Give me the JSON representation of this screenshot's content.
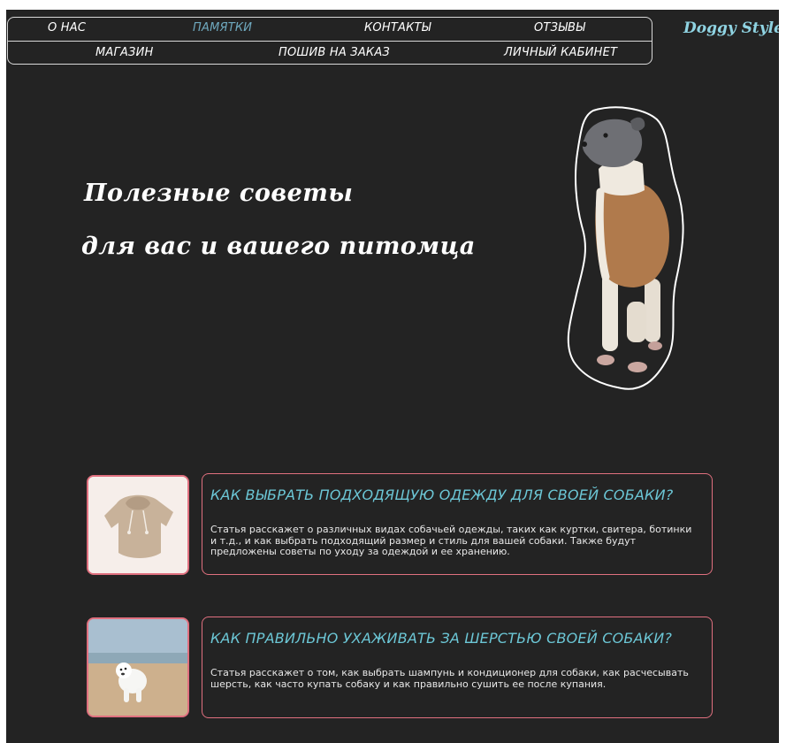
{
  "nav": {
    "items": [
      "О НАС",
      "ПАМЯТКИ",
      "КОНТАКТЫ",
      "ОТЗЫВЫ",
      "МАГАЗИН",
      "ПОШИВ НА ЗАКАЗ",
      "ЛИЧНЫЙ КАБИНЕТ"
    ],
    "active": "ПАМЯТКИ"
  },
  "brand": "Doggy Style",
  "hero": {
    "line1": "Полезные советы",
    "line2": "для вас и вашего питомца"
  },
  "articles": [
    {
      "title": "КАК ВЫБРАТЬ ПОДХОДЯЩУЮ ОДЕЖДУ ДЛЯ СВОЕЙ СОБАКИ?",
      "text": "Статья расскажет о различных видах собачьей одежды, таких как куртки, свитера, ботинки и т.д., и как выбрать подходящий размер и стиль для вашей собаки. Также будут предложены советы по уходу за одеждой и ее хранению."
    },
    {
      "title": "КАК ПРАВИЛЬНО УХАЖИВАТЬ ЗА ШЕРСТЬЮ СВОЕЙ СОБАКИ?",
      "text": "Статья расскажет о том, как выбрать шампунь и кондиционер для собаки, как расчесывать шерсть, как часто купать собаку и как правильно сушить ее после купания."
    }
  ],
  "colors": {
    "background": "#232323",
    "accent_title": "#6cc7d6",
    "card_border": "#e0707f",
    "active_nav": "#6fa9bf"
  }
}
